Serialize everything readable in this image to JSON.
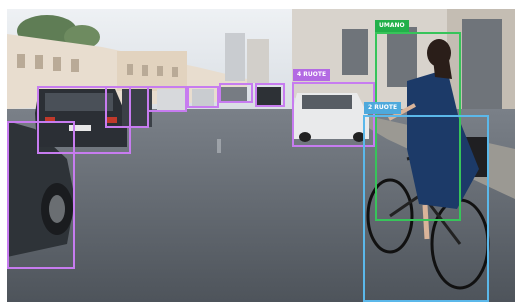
{
  "scene": {
    "description_colors": {
      "sky": "#dfe4ea",
      "road": "#5d636a",
      "building_left": "#e7dccd",
      "building_right": "#d7d2cb"
    }
  },
  "colors": {
    "car_box": "#c77cf0",
    "car_label_bg": "#b36ae3",
    "bike_box": "#5bb8ea",
    "bike_label_bg": "#4ea9dc",
    "human_box": "#37c45a",
    "human_label_bg": "#22b04a"
  },
  "detections": {
    "car_label": "4 RUOTE",
    "bike_label": "2 RUOTE",
    "human_label": "UMANO"
  }
}
